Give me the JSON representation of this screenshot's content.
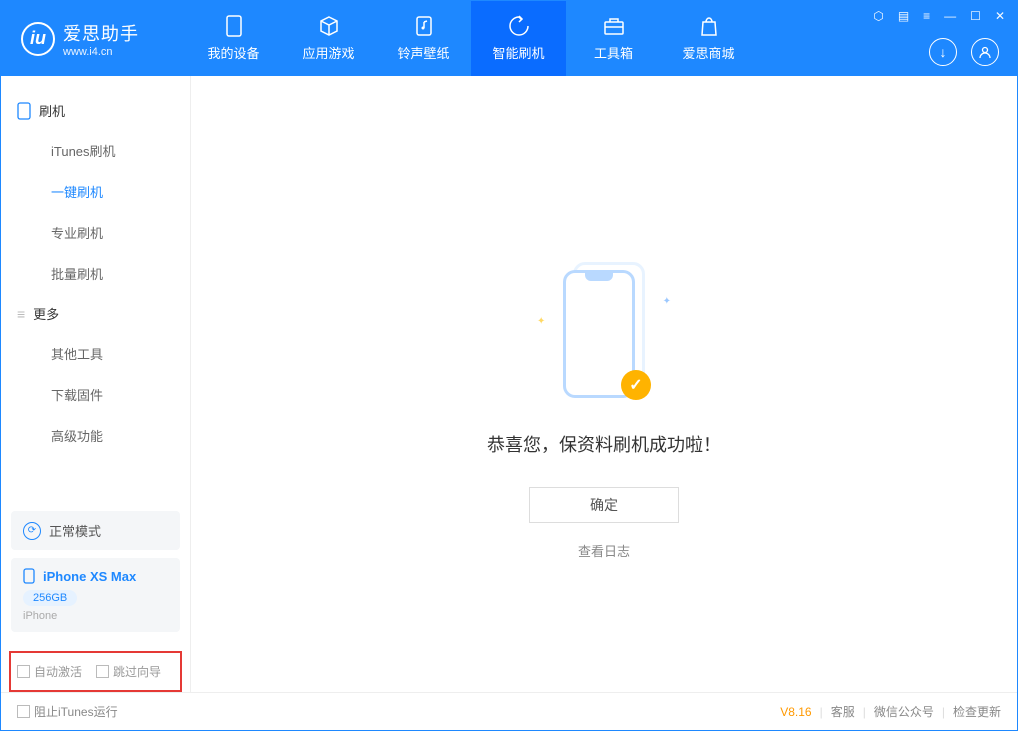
{
  "app": {
    "name": "爱思助手",
    "url": "www.i4.cn"
  },
  "nav": {
    "tabs": [
      {
        "label": "我的设备",
        "icon": "device"
      },
      {
        "label": "应用游戏",
        "icon": "cube"
      },
      {
        "label": "铃声壁纸",
        "icon": "music"
      },
      {
        "label": "智能刷机",
        "icon": "refresh"
      },
      {
        "label": "工具箱",
        "icon": "toolbox"
      },
      {
        "label": "爱思商城",
        "icon": "bag"
      }
    ]
  },
  "sidebar": {
    "sections": [
      {
        "title": "刷机",
        "items": [
          "iTunes刷机",
          "一键刷机",
          "专业刷机",
          "批量刷机"
        ]
      },
      {
        "title": "更多",
        "items": [
          "其他工具",
          "下载固件",
          "高级功能"
        ]
      }
    ],
    "selected": "一键刷机",
    "mode": "正常模式",
    "device": {
      "name": "iPhone XS Max",
      "storage": "256GB",
      "type": "iPhone"
    },
    "options": {
      "auto_activate": "自动激活",
      "skip_guide": "跳过向导"
    }
  },
  "main": {
    "success": "恭喜您，保资料刷机成功啦！",
    "ok": "确定",
    "log_link": "查看日志"
  },
  "footer": {
    "block_itunes": "阻止iTunes运行",
    "version": "V8.16",
    "links": [
      "客服",
      "微信公众号",
      "检查更新"
    ]
  }
}
